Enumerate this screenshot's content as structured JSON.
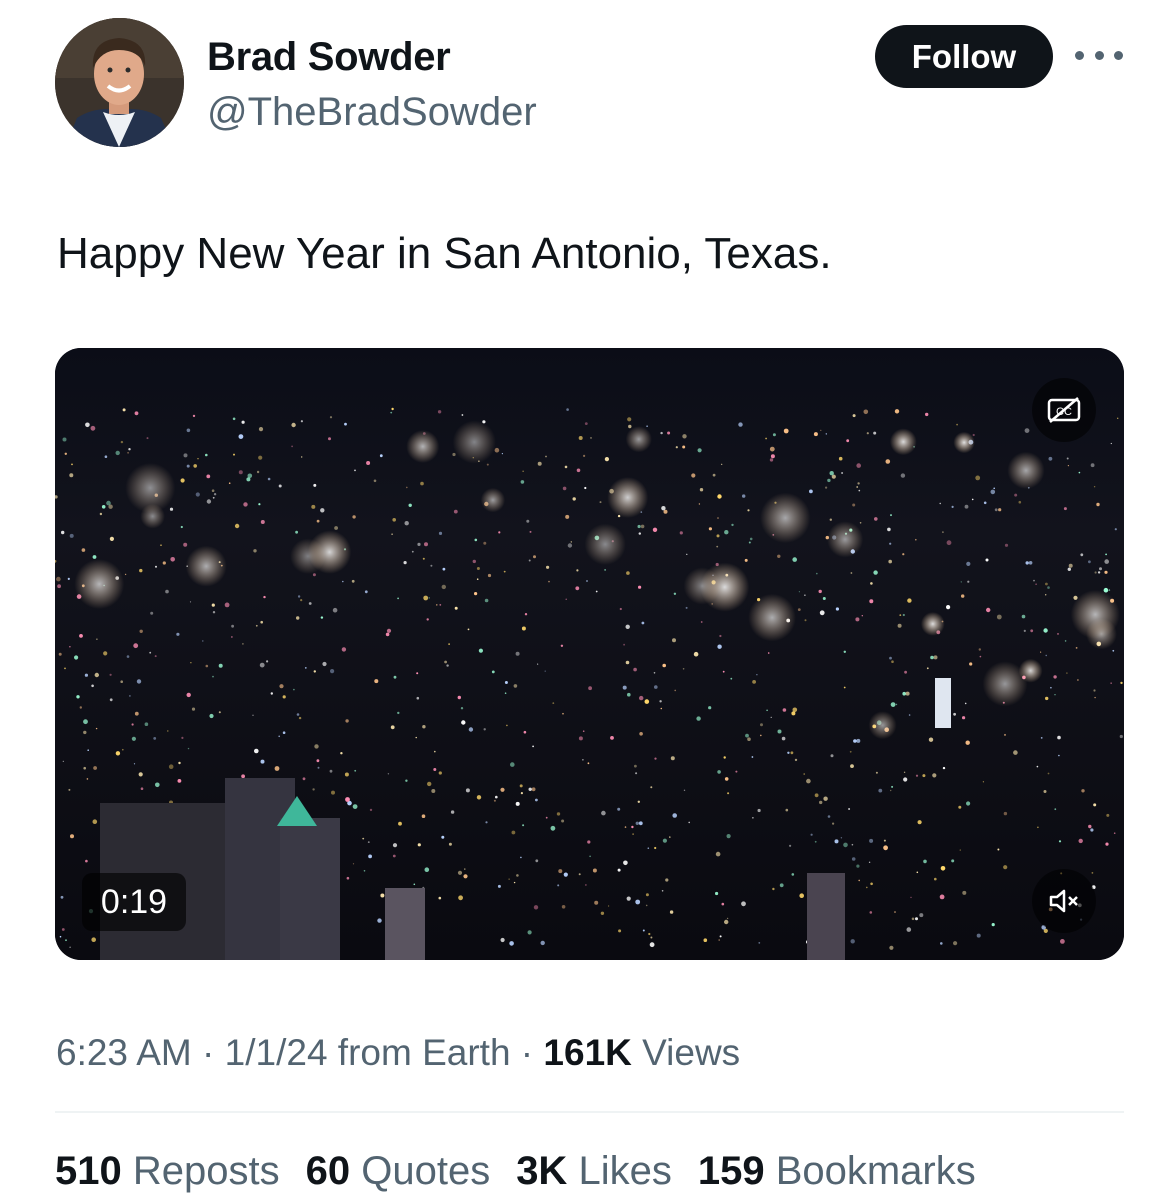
{
  "author": {
    "display_name": "Brad Sowder",
    "handle": "@TheBradSowder",
    "avatar_icon": "profile-photo"
  },
  "follow_label": "Follow",
  "more_icon": "more-horizontal-icon",
  "tweet": {
    "text": "Happy New Year in San Antonio, Texas."
  },
  "video": {
    "duration": "0:19",
    "captions_icon": "captions-off-icon",
    "mute_icon": "muted-speaker-icon"
  },
  "meta": {
    "time": "6:23 AM",
    "separator1": " · ",
    "date_source": "1/1/24 from Earth",
    "separator2": " · ",
    "views_count": "161K",
    "views_label": " Views"
  },
  "stats": [
    {
      "count": "510",
      "label": " Reposts"
    },
    {
      "count": "60",
      "label": " Quotes"
    },
    {
      "count": "3K",
      "label": " Likes"
    },
    {
      "count": "159",
      "label": " Bookmarks"
    }
  ],
  "colors": {
    "text_primary": "#0f1419",
    "text_secondary": "#536471",
    "follow_bg": "#0f1419",
    "divider": "#eff3f4"
  }
}
